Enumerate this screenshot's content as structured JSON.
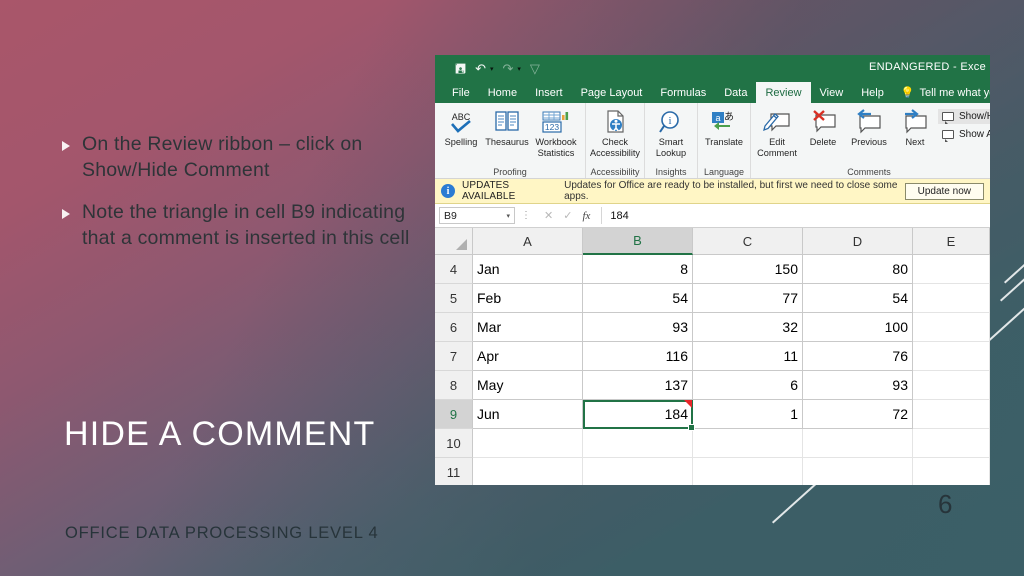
{
  "slide": {
    "bullets": [
      "On the Review ribbon – click on Show/Hide Comment",
      "Note the triangle in cell B9 indicating that a comment is inserted in this cell"
    ],
    "title": "HIDE A COMMENT",
    "footer": "OFFICE DATA PROCESSING LEVEL 4",
    "page_number": "6",
    "colors": {
      "gradient_top_left": "#a9566a",
      "gradient_bottom_right": "#3c6a72",
      "title_color": "#ffffff",
      "body_text_color": "#2e3438"
    }
  },
  "excel": {
    "document_title": "ENDANGERED  -  Exce",
    "quick_access": [
      {
        "name": "save-icon",
        "glyph": "὚B"
      },
      {
        "name": "undo-icon",
        "glyph": "↶"
      },
      {
        "name": "redo-icon",
        "glyph": "↷"
      },
      {
        "name": "customize-qat-icon",
        "glyph": "▽"
      }
    ],
    "tabs": [
      {
        "label": "File",
        "active": false
      },
      {
        "label": "Home",
        "active": false
      },
      {
        "label": "Insert",
        "active": false
      },
      {
        "label": "Page Layout",
        "active": false
      },
      {
        "label": "Formulas",
        "active": false
      },
      {
        "label": "Data",
        "active": false
      },
      {
        "label": "Review",
        "active": true
      },
      {
        "label": "View",
        "active": false
      },
      {
        "label": "Help",
        "active": false
      }
    ],
    "tell_me": "Tell me what you want to",
    "ribbon": {
      "groups": [
        {
          "label": "Proofing",
          "buttons": [
            {
              "caption": "Spelling",
              "icon": "spelling-icon"
            },
            {
              "caption": "Thesaurus",
              "icon": "thesaurus-icon"
            },
            {
              "caption": "Workbook Statistics",
              "icon": "workbook-statistics-icon"
            }
          ]
        },
        {
          "label": "Accessibility",
          "buttons": [
            {
              "caption": "Check Accessibility",
              "icon": "check-accessibility-icon"
            }
          ]
        },
        {
          "label": "Insights",
          "buttons": [
            {
              "caption": "Smart Lookup",
              "icon": "smart-lookup-icon"
            }
          ]
        },
        {
          "label": "Language",
          "buttons": [
            {
              "caption": "Translate",
              "icon": "translate-icon"
            }
          ]
        },
        {
          "label": "Comments",
          "buttons": [
            {
              "caption": "Edit Comment",
              "icon": "edit-comment-icon"
            },
            {
              "caption": "Delete",
              "icon": "delete-comment-icon"
            },
            {
              "caption": "Previous",
              "icon": "previous-comment-icon"
            },
            {
              "caption": "Next",
              "icon": "next-comment-icon"
            }
          ],
          "stacked": [
            {
              "label": "Show/Hide Comment",
              "icon": "show-hide-comment-icon",
              "highlighted": true
            },
            {
              "label": "Show All Comments",
              "icon": "show-all-comments-icon",
              "highlighted": false
            }
          ]
        }
      ]
    },
    "banner": {
      "title": "UPDATES AVAILABLE",
      "message": "Updates for Office are ready to be installed, but first we need to close some apps.",
      "button": "Update now"
    },
    "formula_bar": {
      "name_box": "B9",
      "cancel_icon": "cancel-icon",
      "confirm_icon": "confirm-icon",
      "function_icon": "insert-function-icon",
      "value": "184"
    },
    "grid": {
      "columns": [
        "A",
        "B",
        "C",
        "D",
        "E"
      ],
      "selected_column": "B",
      "selected_row": "9",
      "selected_cell": "B9",
      "comment_cell": "B9",
      "rows": [
        {
          "num": "4",
          "cells": [
            "Jan",
            "8",
            "150",
            "80",
            ""
          ]
        },
        {
          "num": "5",
          "cells": [
            "Feb",
            "54",
            "77",
            "54",
            ""
          ]
        },
        {
          "num": "6",
          "cells": [
            "Mar",
            "93",
            "32",
            "100",
            ""
          ]
        },
        {
          "num": "7",
          "cells": [
            "Apr",
            "116",
            "11",
            "76",
            ""
          ]
        },
        {
          "num": "8",
          "cells": [
            "May",
            "137",
            "6",
            "93",
            ""
          ]
        },
        {
          "num": "9",
          "cells": [
            "Jun",
            "184",
            "1",
            "72",
            ""
          ]
        },
        {
          "num": "10",
          "cells": [
            "",
            "",
            "",
            "",
            ""
          ]
        },
        {
          "num": "11",
          "cells": [
            "",
            "",
            "",
            "",
            ""
          ]
        }
      ]
    }
  }
}
